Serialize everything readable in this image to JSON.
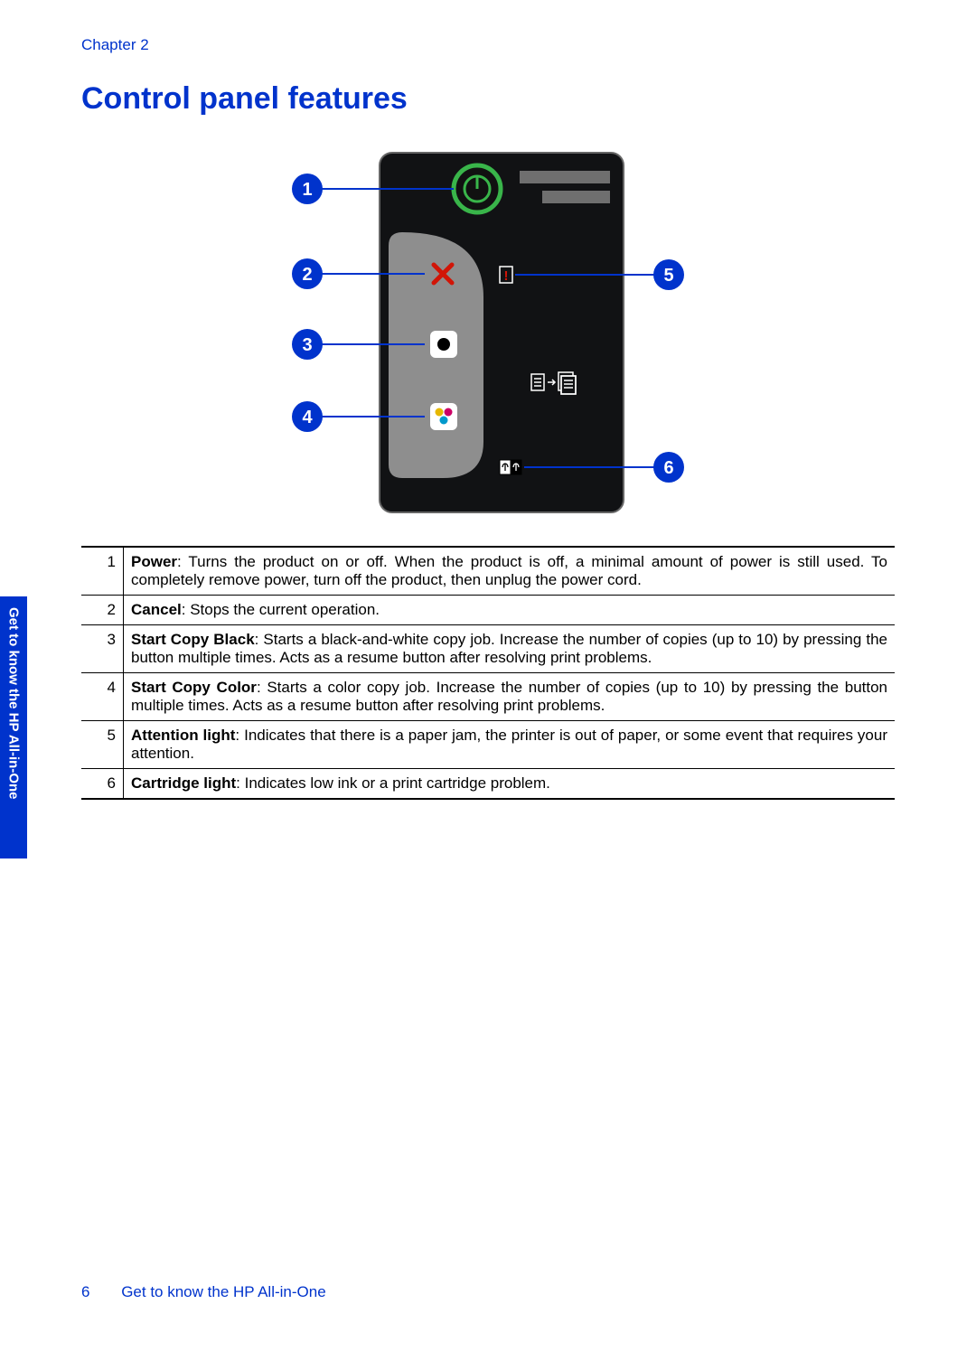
{
  "chapter_label": "Chapter 2",
  "title": "Control panel features",
  "side_tab": "Get to know the HP All-in-One",
  "footer": {
    "page_number": "6",
    "section": "Get to know the HP All-in-One"
  },
  "callouts": {
    "1": "1",
    "2": "2",
    "3": "3",
    "4": "4",
    "5": "5",
    "6": "6"
  },
  "features": [
    {
      "num": "1",
      "label": "Power",
      "desc": ": Turns the product on or off. When the product is off, a minimal amount of power is still used. To completely remove power, turn off the product, then unplug the power cord."
    },
    {
      "num": "2",
      "label": "Cancel",
      "desc": ": Stops the current operation."
    },
    {
      "num": "3",
      "label": "Start Copy Black",
      "desc": ": Starts a black-and-white copy job. Increase the number of copies (up to 10) by pressing the button multiple times. Acts as a resume button after resolving print problems."
    },
    {
      "num": "4",
      "label": "Start Copy Color",
      "desc": ": Starts a color copy job. Increase the number of copies (up to 10) by pressing the button multiple times. Acts as a resume button after resolving print problems."
    },
    {
      "num": "5",
      "label": "Attention light",
      "desc": ": Indicates that there is a paper jam, the printer is out of paper, or some event that requires your attention."
    },
    {
      "num": "6",
      "label": "Cartridge light",
      "desc": ": Indicates low ink or a print cartridge problem."
    }
  ]
}
